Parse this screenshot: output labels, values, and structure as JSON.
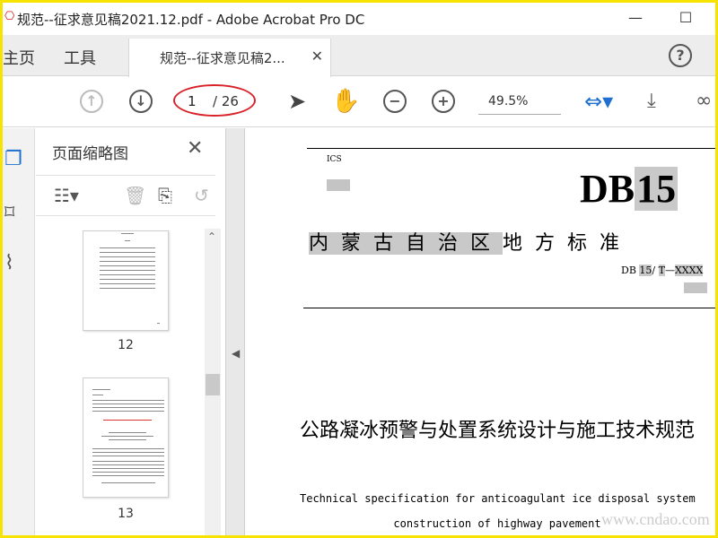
{
  "window": {
    "title": "规范--征求意见稿2021.12.pdf - Adobe Acrobat Pro DC",
    "minimize": "—",
    "maximize": "☐"
  },
  "tabs": {
    "home": "主页",
    "tools": "工具",
    "document": "规范--征求意见稿2...",
    "close": "✕",
    "help": "?"
  },
  "toolbar": {
    "page_current": "1",
    "page_total": "/ 26",
    "zoom": "49.5%"
  },
  "thumbnails_panel": {
    "title": "页面缩略图",
    "close": "✕",
    "pages": [
      {
        "label": "12"
      },
      {
        "label": "13"
      }
    ]
  },
  "document": {
    "ics": "ICS",
    "code_prefix": "DB",
    "code_number": "15",
    "region": "内蒙古自治区",
    "region_rest": "地方标准",
    "standard_no_prefix": "DB",
    "standard_no_num": "15",
    "standard_no_sep": "/",
    "standard_no_t": "T",
    "standard_no_xxxx": "XXXX",
    "title_cn": "公路凝冰预警与处置系统设计与施工技术规范",
    "title_en_line1": "Technical specification for anticoagulant ice disposal system",
    "title_en_line2": "construction of highway pavement"
  },
  "watermark": "www.cndao.com",
  "colors": {
    "accent_blue": "#1f6fcf",
    "annotation_red": "#d8232a",
    "frame_yellow": "#f6e300",
    "highlight_grey": "#c9c9c9"
  }
}
